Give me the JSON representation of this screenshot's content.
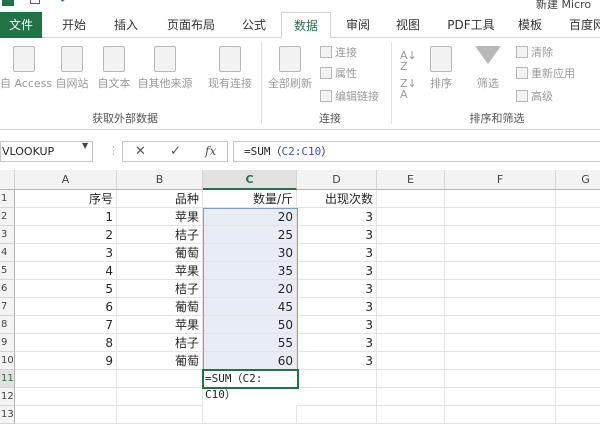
{
  "titlebar": {
    "app_title": "新建 Micro"
  },
  "tabs": [
    {
      "label": "文件",
      "name": "tab-file"
    },
    {
      "label": "开始",
      "name": "tab-home"
    },
    {
      "label": "插入",
      "name": "tab-insert"
    },
    {
      "label": "页面布局",
      "name": "tab-page-layout"
    },
    {
      "label": "公式",
      "name": "tab-formulas"
    },
    {
      "label": "数据",
      "name": "tab-data"
    },
    {
      "label": "审阅",
      "name": "tab-review"
    },
    {
      "label": "视图",
      "name": "tab-view"
    },
    {
      "label": "PDF工具",
      "name": "tab-pdf-tools"
    },
    {
      "label": "模板",
      "name": "tab-templates"
    },
    {
      "label": "百度网",
      "name": "tab-baidu"
    }
  ],
  "ribbon": {
    "external": {
      "access": "自 Access",
      "web": "自网站",
      "text": "自文本",
      "other": "自其他来源",
      "existing": "现有连接",
      "group_label": "获取外部数据"
    },
    "connections": {
      "refresh_all": "全部刷新",
      "connections": "连接",
      "properties": "属性",
      "edit_links": "编辑链接",
      "group_label": "连接"
    },
    "sort_filter": {
      "sort": "排序",
      "filter": "筛选",
      "clear": "清除",
      "reapply": "重新应用",
      "advanced": "高级",
      "group_label": "排序和筛选"
    }
  },
  "formula_bar": {
    "name_box": "VLOOKUP",
    "cancel_symbol": "✕",
    "enter_symbol": "✓",
    "fx_symbol": "fx",
    "formula_prefix": "=SUM（",
    "formula_ref": "C2:C10",
    "formula_suffix": "）"
  },
  "columns": [
    "A",
    "B",
    "C",
    "D",
    "E",
    "F",
    "G"
  ],
  "rows": [
    "1",
    "2",
    "3",
    "4",
    "5",
    "6",
    "7",
    "8",
    "9",
    "10",
    "11",
    "12",
    "13"
  ],
  "headers": {
    "a": "序号",
    "b": "品种",
    "c": "数量/斤",
    "d": "出现次数"
  },
  "table": [
    {
      "a": "1",
      "b": "苹果",
      "c": "20",
      "d": "3"
    },
    {
      "a": "2",
      "b": "桔子",
      "c": "25",
      "d": "3"
    },
    {
      "a": "3",
      "b": "葡萄",
      "c": "30",
      "d": "3"
    },
    {
      "a": "4",
      "b": "苹果",
      "c": "35",
      "d": "3"
    },
    {
      "a": "5",
      "b": "桔子",
      "c": "20",
      "d": "3"
    },
    {
      "a": "6",
      "b": "葡萄",
      "c": "45",
      "d": "3"
    },
    {
      "a": "7",
      "b": "苹果",
      "c": "50",
      "d": "3"
    },
    {
      "a": "8",
      "b": "桔子",
      "c": "55",
      "d": "3"
    },
    {
      "a": "9",
      "b": "葡萄",
      "c": "60",
      "d": "3"
    }
  ],
  "edit_cell": {
    "prefix": "=SUM（C2:",
    "line2": "C10）"
  },
  "colors": {
    "accent": "#217346",
    "selection": "#e7ecf7",
    "reference": "#2a57c0"
  }
}
